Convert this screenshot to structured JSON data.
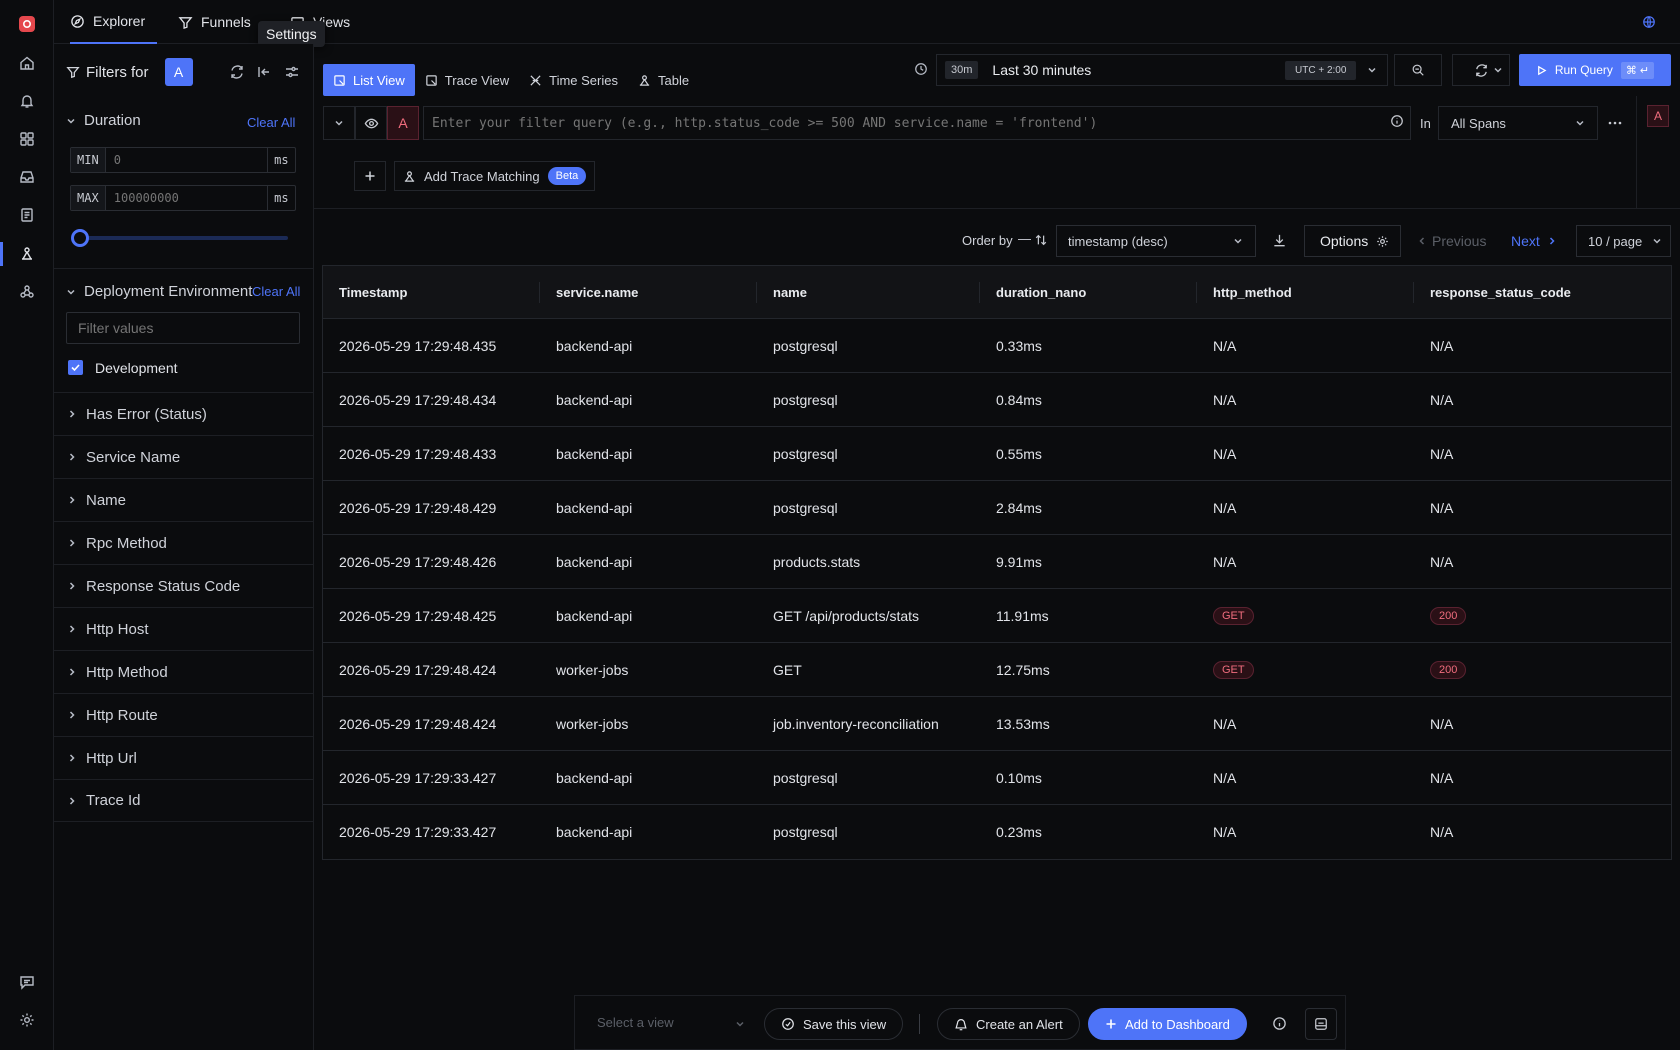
{
  "nav_tabs": [
    {
      "label": "Explorer",
      "icon": "compass-icon"
    },
    {
      "label": "Funnels",
      "icon": "funnel-icon"
    },
    {
      "label": "Views",
      "icon": "views-icon"
    }
  ],
  "tooltip": "Settings",
  "filters": {
    "title": "Filters for",
    "query_badge": "A",
    "duration": {
      "title": "Duration",
      "clear_label": "Clear All",
      "min_label": "MIN",
      "min_placeholder": "0",
      "max_label": "MAX",
      "max_placeholder": "100000000",
      "unit": "ms",
      "slider_value": 0
    },
    "deployment": {
      "title": "Deployment Environment",
      "clear_label": "Clear All",
      "search_placeholder": "Filter values",
      "options": [
        {
          "label": "Development",
          "checked": true
        }
      ]
    },
    "collapsed_sections": [
      "Has Error (Status)",
      "Service Name",
      "Name",
      "Rpc Method",
      "Response Status Code",
      "Http Host",
      "Http Method",
      "Http Route",
      "Http Url",
      "Trace Id"
    ]
  },
  "view_tabs": [
    {
      "label": "List View",
      "active": true
    },
    {
      "label": "Trace View",
      "active": false
    },
    {
      "label": "Time Series",
      "active": false
    },
    {
      "label": "Table",
      "active": false
    }
  ],
  "time": {
    "short": "30m",
    "label": "Last 30 minutes",
    "timezone": "UTC + 2:00"
  },
  "run_query": {
    "label": "Run Query",
    "shortcut": "⌘ ↵"
  },
  "query": {
    "badge": "A",
    "placeholder": "Enter your filter query (e.g., http.status_code >= 500 AND service.name = 'frontend')",
    "in_label": "In",
    "span_scope": "All Spans",
    "right_badge": "A"
  },
  "trace_matching": {
    "label": "Add Trace Matching",
    "badge": "Beta"
  },
  "order": {
    "label": "Order by",
    "value": "timestamp (desc)",
    "options_label": "Options",
    "previous": "Previous",
    "next": "Next",
    "page_size": "10 / page"
  },
  "table": {
    "columns": [
      "Timestamp",
      "service.name",
      "name",
      "duration_nano",
      "http_method",
      "response_status_code"
    ],
    "rows": [
      [
        "2026-05-29 17:29:48.435",
        "backend-api",
        "postgresql",
        "0.33ms",
        "N/A",
        "N/A"
      ],
      [
        "2026-05-29 17:29:48.434",
        "backend-api",
        "postgresql",
        "0.84ms",
        "N/A",
        "N/A"
      ],
      [
        "2026-05-29 17:29:48.433",
        "backend-api",
        "postgresql",
        "0.55ms",
        "N/A",
        "N/A"
      ],
      [
        "2026-05-29 17:29:48.429",
        "backend-api",
        "postgresql",
        "2.84ms",
        "N/A",
        "N/A"
      ],
      [
        "2026-05-29 17:29:48.426",
        "backend-api",
        "products.stats",
        "9.91ms",
        "N/A",
        "N/A"
      ],
      [
        "2026-05-29 17:29:48.425",
        "backend-api",
        "GET /api/products/stats",
        "11.91ms",
        "GET",
        "200"
      ],
      [
        "2026-05-29 17:29:48.424",
        "worker-jobs",
        "GET",
        "12.75ms",
        "GET",
        "200"
      ],
      [
        "2026-05-29 17:29:48.424",
        "worker-jobs",
        "job.inventory-reconciliation",
        "13.53ms",
        "N/A",
        "N/A"
      ],
      [
        "2026-05-29 17:29:33.427",
        "backend-api",
        "postgresql",
        "0.10ms",
        "N/A",
        "N/A"
      ],
      [
        "2026-05-29 17:29:33.427",
        "backend-api",
        "postgresql",
        "0.23ms",
        "N/A",
        "N/A"
      ]
    ]
  },
  "bottom_bar": {
    "select_placeholder": "Select a view",
    "save_label": "Save this view",
    "alert_label": "Create an Alert",
    "dashboard_label": "Add to Dashboard"
  },
  "colors": {
    "accent": "#4e74f8",
    "pill_text": "#f06d7e",
    "background": "#0b0c0e"
  }
}
